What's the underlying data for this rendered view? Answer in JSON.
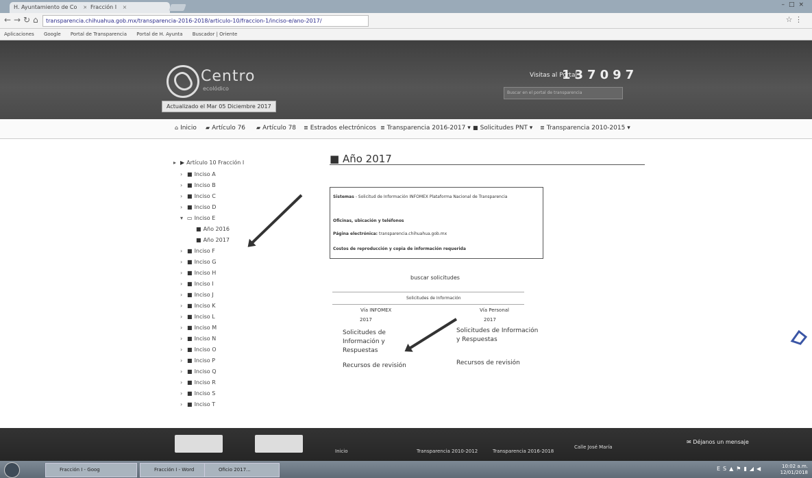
{
  "browser": {
    "tabs": [
      {
        "label": "H. Ayuntamiento de Co"
      },
      {
        "label": "Fracción I"
      }
    ],
    "url": "transparencia.chihuahua.gob.mx/transparencia-2016-2018/articulo-10/fraccion-1/inciso-e/ano-2017/",
    "bookmarks": [
      "Aplicaciones",
      "Google",
      "Portal de Transparencia",
      "Portal de H. Ayunta",
      "Buscador | Oriente"
    ]
  },
  "header": {
    "logo_name": "Centro",
    "logo_sub": "ecolódico",
    "updated": "Actualizado el Mar 05 Diciembre 2017",
    "visits_label": "Visitas al Portal",
    "visits_count": "137097",
    "search_placeholder": "Buscar en el portal de transparencia"
  },
  "nav": [
    {
      "icon": "home-icon",
      "label": "Inicio"
    },
    {
      "icon": "book-icon",
      "label": "Artículo 76"
    },
    {
      "icon": "book-icon",
      "label": "Artículo 78"
    },
    {
      "icon": "list-icon",
      "label": "Estrados electrónicos"
    },
    {
      "icon": "list-icon",
      "label": "Transparencia 2016-2017 ▾"
    },
    {
      "icon": "folder-icon",
      "label": "Solicitudes PNT ▾"
    },
    {
      "icon": "list-icon",
      "label": "Transparencia 2010-2015 ▾"
    }
  ],
  "tree": {
    "root": "Artículo 10 Fracción I",
    "items": [
      "Inciso A",
      "Inciso B",
      "Inciso C",
      "Inciso D",
      "Inciso E",
      "Año 2016",
      "Año 2017",
      "Inciso F",
      "Inciso G",
      "Inciso H",
      "Inciso I",
      "Inciso J",
      "Inciso K",
      "Inciso L",
      "Inciso M",
      "Inciso N",
      "Inciso O",
      "Inciso P",
      "Inciso Q",
      "Inciso R",
      "Inciso S",
      "Inciso T"
    ]
  },
  "main": {
    "title": "Año 2017",
    "info": {
      "systems_label": "Sistemas",
      "systems_value": "- Solicitud de Información INFOMEX Plataforma Nacional de Transparencia",
      "offices_label": "Oficinas, ubicación y teléfonos",
      "email_label": "Página electrónica:",
      "email_value": "transparencia.chihuahua.gob.mx",
      "costs_label": "Costos de reproducción y copia de información requerida"
    },
    "search_requests": "buscar solicitudes",
    "requests_heading": "Solicitudes de Información",
    "columns": [
      {
        "head": "Vía INFOMEX",
        "year": "2017",
        "link1": "Solicitudes de Información y Respuestas",
        "link2": "Recursos de revisión"
      },
      {
        "head": "Vía Personal",
        "year": "2017",
        "link1": "Solicitudes de Información y Respuestas",
        "link2": "Recursos de revisión"
      }
    ]
  },
  "footer": {
    "links": [
      "Inicio",
      "Transparencia 2010-2012",
      "Transparencia 2016-2018",
      "Calle José María"
    ],
    "message_button": "Déjanos un mensaje"
  },
  "taskbar": {
    "tasks": [
      "Fracción I - Goog",
      "Fracción I - Word",
      "Oficio 2017..."
    ],
    "time": "10:02 a.m.",
    "date": "12/01/2018"
  }
}
